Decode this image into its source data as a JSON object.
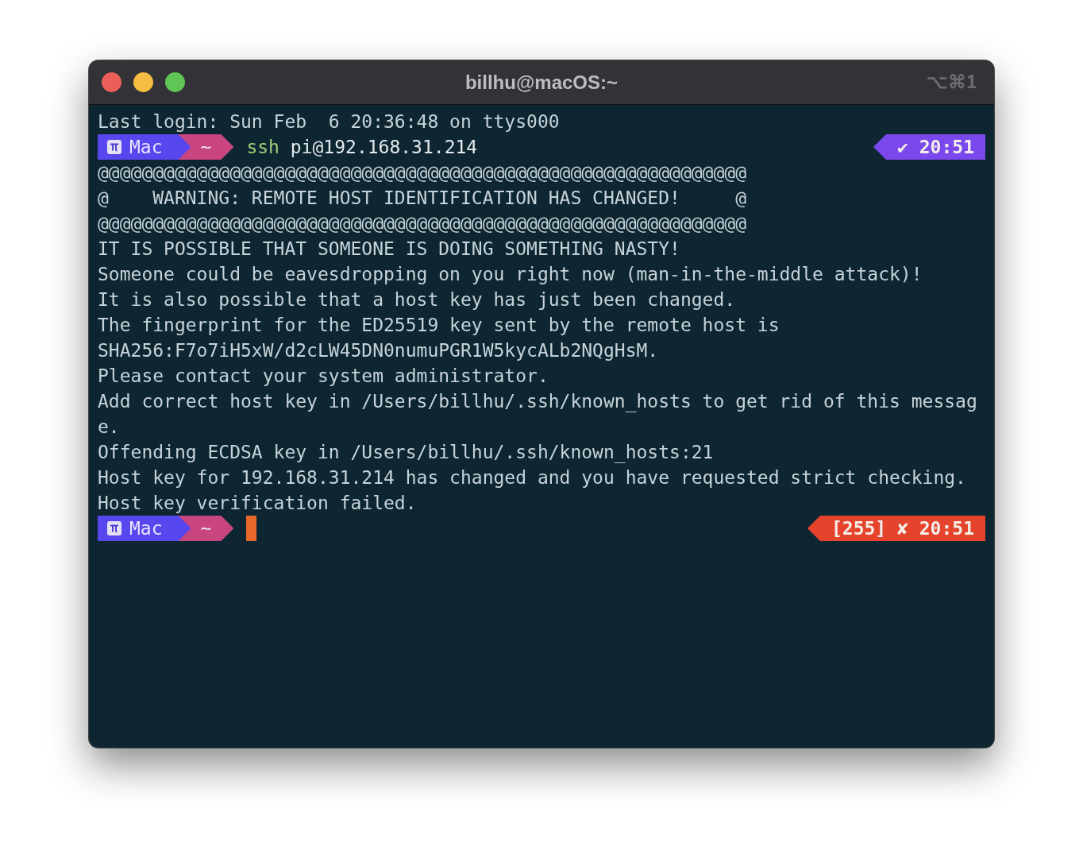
{
  "window": {
    "title": "billhu@macOS:~",
    "shortcut": "⌥⌘1"
  },
  "lines": [
    {
      "kind": "text",
      "text": "Last login: Sun Feb  6 20:36:48 on ttys000"
    },
    {
      "kind": "prompt",
      "host": "Mac",
      "dir": "~",
      "command": "ssh",
      "args": " pi@192.168.31.214",
      "cursor": false,
      "status": {
        "kind": "ok",
        "text": "✔ 20:51"
      }
    },
    {
      "kind": "text",
      "text": "@@@@@@@@@@@@@@@@@@@@@@@@@@@@@@@@@@@@@@@@@@@@@@@@@@@@@@@@@@@"
    },
    {
      "kind": "text",
      "text": "@    WARNING: REMOTE HOST IDENTIFICATION HAS CHANGED!     @"
    },
    {
      "kind": "text",
      "text": "@@@@@@@@@@@@@@@@@@@@@@@@@@@@@@@@@@@@@@@@@@@@@@@@@@@@@@@@@@@"
    },
    {
      "kind": "text",
      "text": "IT IS POSSIBLE THAT SOMEONE IS DOING SOMETHING NASTY!"
    },
    {
      "kind": "text",
      "text": "Someone could be eavesdropping on you right now (man-in-the-middle attack)!"
    },
    {
      "kind": "text",
      "text": "It is also possible that a host key has just been changed."
    },
    {
      "kind": "text",
      "text": "The fingerprint for the ED25519 key sent by the remote host is"
    },
    {
      "kind": "text",
      "text": "SHA256:F7o7iH5xW/d2cLW45DN0numuPGR1W5kycALb2NQgHsM."
    },
    {
      "kind": "text",
      "text": "Please contact your system administrator."
    },
    {
      "kind": "text",
      "text": "Add correct host key in /Users/billhu/.ssh/known_hosts to get rid of this messag"
    },
    {
      "kind": "text",
      "text": "e."
    },
    {
      "kind": "text",
      "text": "Offending ECDSA key in /Users/billhu/.ssh/known_hosts:21"
    },
    {
      "kind": "text",
      "text": "Host key for 192.168.31.214 has changed and you have requested strict checking."
    },
    {
      "kind": "text",
      "text": "Host key verification failed."
    },
    {
      "kind": "prompt",
      "host": "Mac",
      "dir": "~",
      "cursor": true,
      "status": {
        "kind": "error",
        "text": "[255] ✘ 20:51"
      }
    }
  ]
}
